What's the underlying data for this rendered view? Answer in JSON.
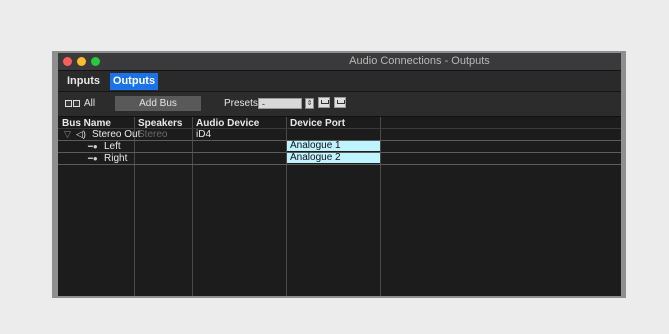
{
  "window": {
    "title": "Audio Connections - Outputs",
    "traffic_lights": [
      "#ff5f57",
      "#febc2e",
      "#28c840"
    ]
  },
  "tabs": [
    {
      "label": "Inputs",
      "active": false
    },
    {
      "label": "Outputs",
      "active": true
    }
  ],
  "toolbar": {
    "all_label": "All",
    "add_bus_label": "Add Bus",
    "presets_label": "Presets",
    "presets_value": "-"
  },
  "table": {
    "headers": [
      "Bus Name",
      "Speakers",
      "Audio Device",
      "Device Port"
    ],
    "bus": {
      "name": "Stereo Out",
      "speakers": "Stereo",
      "audio_device": "iD4"
    },
    "channels": [
      {
        "name": "Left",
        "device_port": "Analogue 1"
      },
      {
        "name": "Right",
        "device_port": "Analogue 2"
      }
    ]
  },
  "accent_color": "#1a73e8",
  "port_highlight_color": "#bff3ff"
}
